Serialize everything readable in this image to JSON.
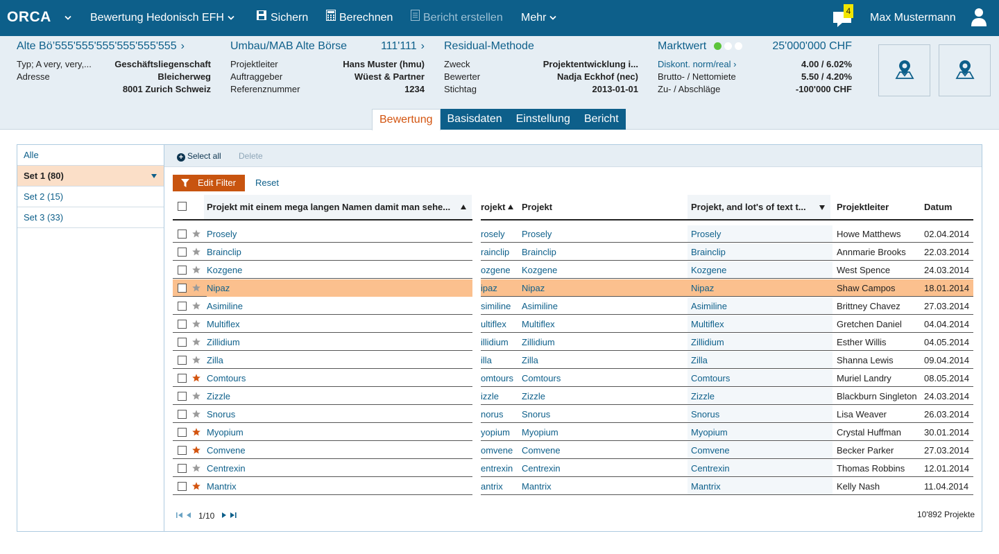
{
  "app": {
    "logo": "ORCA",
    "menu": {
      "model": "Bewertung Hedonisch EFH",
      "save": "Sichern",
      "calculate": "Berechnen",
      "report": "Bericht erstellen",
      "more": "Mehr"
    },
    "notifications_count": "4",
    "user_name": "Max Mustermann"
  },
  "info": {
    "property": {
      "title": "Alte Bö’555'555'555'555'555'555",
      "rows": [
        {
          "k": "Typ; A very, very,...",
          "v": "Geschäftsliegenschaft"
        },
        {
          "k": "Adresse",
          "v": "Bleicherweg"
        },
        {
          "k": "",
          "v": "8001 Zurich Schweiz"
        }
      ]
    },
    "project": {
      "title": "Umbau/MAB Alte Börse",
      "value": "111'111",
      "rows": [
        {
          "k": "Projektleiter",
          "v": "Hans Muster (hmu)"
        },
        {
          "k": "Auftraggeber",
          "v": "Wüest & Partner"
        },
        {
          "k": "Referenznummer",
          "v": "1234"
        }
      ]
    },
    "method": {
      "title": "Residual-Methode",
      "rows": [
        {
          "k": "Zweck",
          "v": "Projektentwicklung i..."
        },
        {
          "k": "Bewerter",
          "v": "Nadja Eckhof (nec)"
        },
        {
          "k": "Stichtag",
          "v": "2013-01-01"
        }
      ]
    },
    "market": {
      "title": "Marktwert",
      "value": "25'000'000 CHF",
      "link": "Diskont. norm/real",
      "rows": [
        {
          "k": "",
          "v": "4.00 / 6.02%"
        },
        {
          "k": "Brutto- / Nettomiete",
          "v": "5.50 / 4.20%"
        },
        {
          "k": "Zu- / Abschläge",
          "v": "-100'000 CHF"
        }
      ]
    }
  },
  "tabs": [
    "Bewertung",
    "Basisdaten",
    "Einstellung",
    "Bericht"
  ],
  "sidebar": {
    "items": [
      "Alle",
      "Set 1 (80)",
      "Set 2 (15)",
      "Set 3 (33)"
    ]
  },
  "toolbar": {
    "select_all": "Select all",
    "delete": "Delete",
    "edit_filter": "Edit Filter",
    "reset": "Reset"
  },
  "grid": {
    "headers": {
      "project_long": "Projekt mit einem mega langen Namen damit man sehe...",
      "project_partial": "rojekt",
      "project": "Projekt",
      "project_text": "Projekt, and lot's of text t...",
      "lead": "Projektleiter",
      "date": "Datum"
    },
    "rows": [
      {
        "name": "Prosely",
        "partial": "rosely",
        "lead": "Howe Matthews",
        "date": "02.04.2014",
        "fav": false
      },
      {
        "name": "Brainclip",
        "partial": "rainclip",
        "lead": "Annmarie Brooks",
        "date": "22.03.2014",
        "fav": false
      },
      {
        "name": "Kozgene",
        "partial": "ozgene",
        "lead": "West Spence",
        "date": "24.03.2014",
        "fav": false
      },
      {
        "name": "Nipaz",
        "partial": "ipaz",
        "lead": "Shaw Campos",
        "date": "18.01.2014",
        "fav": false
      },
      {
        "name": "Asimiline",
        "partial": "similine",
        "lead": "Brittney Chavez",
        "date": "27.03.2014",
        "fav": false
      },
      {
        "name": "Multiflex",
        "partial": "ultiflex",
        "lead": "Gretchen Daniel",
        "date": "04.04.2014",
        "fav": false
      },
      {
        "name": "Zillidium",
        "partial": "illidium",
        "lead": "Esther Willis",
        "date": "04.05.2014",
        "fav": false
      },
      {
        "name": "Zilla",
        "partial": "illa",
        "lead": "Shanna Lewis",
        "date": "09.04.2014",
        "fav": false
      },
      {
        "name": "Comtours",
        "partial": "omtours",
        "lead": "Muriel Landry",
        "date": "08.05.2014",
        "fav": true
      },
      {
        "name": "Zizzle",
        "partial": "izzle",
        "lead": "Blackburn Singleton",
        "date": "24.03.2014",
        "fav": false
      },
      {
        "name": "Snorus",
        "partial": "norus",
        "lead": "Lisa Weaver",
        "date": "26.03.2014",
        "fav": false
      },
      {
        "name": "Myopium",
        "partial": "yopium",
        "lead": "Crystal Huffman",
        "date": "30.01.2014",
        "fav": true
      },
      {
        "name": "Comvene",
        "partial": "omvene",
        "lead": "Becker Parker",
        "date": "27.03.2014",
        "fav": true
      },
      {
        "name": "Centrexin",
        "partial": "entrexin",
        "lead": "Thomas Robbins",
        "date": "12.01.2014",
        "fav": false
      },
      {
        "name": "Mantrix",
        "partial": "antrix",
        "lead": "Kelly Nash",
        "date": "11.04.2014",
        "fav": true
      }
    ],
    "selected_row": "Nipaz"
  },
  "pager": {
    "page": "1/10",
    "total": "10'892 Projekte"
  },
  "colors": {
    "brand": "#0d5f8a",
    "accent": "#c8540f",
    "selected_row": "#fbc08e",
    "favorite_star": "#d3540f",
    "default_star": "#9a9a9a"
  }
}
